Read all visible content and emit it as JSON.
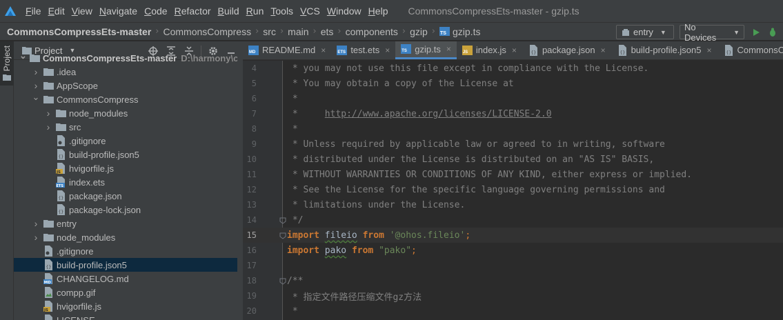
{
  "menu": {
    "items": [
      "File",
      "Edit",
      "View",
      "Navigate",
      "Code",
      "Refactor",
      "Build",
      "Run",
      "Tools",
      "VCS",
      "Window",
      "Help"
    ],
    "window_title": "CommonsCompressEts-master - gzip.ts"
  },
  "breadcrumb": {
    "root": "CommonsCompressEts-master",
    "items": [
      "CommonsCompress",
      "src",
      "main",
      "ets",
      "components",
      "gzip"
    ],
    "file": "gzip.ts"
  },
  "toolbar": {
    "config": "entry",
    "device": "No Devices"
  },
  "stripe": {
    "label": "Project"
  },
  "project_panel": {
    "title": "Project",
    "rows": [
      {
        "name": "CommonsCompressEts-master",
        "note": "D:\\harmony\\cod",
        "indent": 0,
        "chev": "open",
        "icon": "folder"
      },
      {
        "name": ".idea",
        "indent": 1,
        "chev": "closed",
        "icon": "folder"
      },
      {
        "name": "AppScope",
        "indent": 1,
        "chev": "closed",
        "icon": "folder"
      },
      {
        "name": "CommonsCompress",
        "indent": 1,
        "chev": "open",
        "icon": "folder"
      },
      {
        "name": "node_modules",
        "indent": 2,
        "chev": "closed",
        "icon": "folder"
      },
      {
        "name": "src",
        "indent": 2,
        "chev": "closed",
        "icon": "folder"
      },
      {
        "name": ".gitignore",
        "indent": 2,
        "chev": "none",
        "icon": "gitignore"
      },
      {
        "name": "build-profile.json5",
        "indent": 2,
        "chev": "none",
        "icon": "json"
      },
      {
        "name": "hvigorfile.js",
        "indent": 2,
        "chev": "none",
        "icon": "js"
      },
      {
        "name": "index.ets",
        "indent": 2,
        "chev": "none",
        "icon": "ets"
      },
      {
        "name": "package.json",
        "indent": 2,
        "chev": "none",
        "icon": "json"
      },
      {
        "name": "package-lock.json",
        "indent": 2,
        "chev": "none",
        "icon": "json"
      },
      {
        "name": "entry",
        "indent": 1,
        "chev": "closed",
        "icon": "folder"
      },
      {
        "name": "node_modules",
        "indent": 1,
        "chev": "closed",
        "icon": "folder"
      },
      {
        "name": ".gitignore",
        "indent": 1,
        "chev": "none",
        "icon": "gitignore"
      },
      {
        "name": "build-profile.json5",
        "indent": 1,
        "chev": "none",
        "icon": "json",
        "selected": true
      },
      {
        "name": "CHANGELOG.md",
        "indent": 1,
        "chev": "none",
        "icon": "md"
      },
      {
        "name": "compp.gif",
        "indent": 1,
        "chev": "none",
        "icon": "image"
      },
      {
        "name": "hvigorfile.js",
        "indent": 1,
        "chev": "none",
        "icon": "js"
      },
      {
        "name": "LICENSE",
        "indent": 1,
        "chev": "none",
        "icon": "text"
      }
    ]
  },
  "tabs": [
    {
      "label": "README.md",
      "badge": "MD",
      "kind": "md"
    },
    {
      "label": "test.ets",
      "badge": "ETS",
      "kind": "ets"
    },
    {
      "label": "gzip.ts",
      "badge": "TS",
      "kind": "ts",
      "active": true
    },
    {
      "label": "index.js",
      "badge": "JS",
      "kind": "js"
    },
    {
      "label": "package.json",
      "badge": "",
      "kind": "json"
    },
    {
      "label": "build-profile.json5",
      "badge": "",
      "kind": "json"
    },
    {
      "label": "CommonsCompress",
      "badge": "",
      "kind": "json"
    }
  ],
  "code": {
    "lines": [
      {
        "n": "4",
        "text": " * you may not use this file except in compliance with the License."
      },
      {
        "n": "5",
        "text": " * You may obtain a copy of the License at"
      },
      {
        "n": "6",
        "text": " *"
      },
      {
        "n": "7",
        "pre": " *     ",
        "link": "http://www.apache.org/licenses/LICENSE-2.0"
      },
      {
        "n": "8",
        "text": " *"
      },
      {
        "n": "9",
        "text": " * Unless required by applicable law or agreed to in writing, software"
      },
      {
        "n": "10",
        "text": " * distributed under the License is distributed on an \"AS IS\" BASIS,"
      },
      {
        "n": "11",
        "text": " * WITHOUT WARRANTIES OR CONDITIONS OF ANY KIND, either express or implied."
      },
      {
        "n": "12",
        "text": " * See the License for the specific language governing permissions and"
      },
      {
        "n": "13",
        "text": " * limitations under the License."
      },
      {
        "n": "14",
        "text": " */",
        "fold": true
      },
      {
        "n": "15",
        "kw1": "import",
        "id": "fileio",
        "kw2": "from",
        "str": "'@ohos.fileio'",
        "end": ";",
        "fold": true,
        "current": true
      },
      {
        "n": "16",
        "kw1": "import",
        "id": "pako",
        "kw2": "from",
        "str": "\"pako\"",
        "end": ";"
      },
      {
        "n": "17",
        "text": ""
      },
      {
        "n": "18",
        "text": "/**",
        "fold": true
      },
      {
        "n": "19",
        "text": " * 指定文件路径压缩文件gz方法"
      },
      {
        "n": "20",
        "text": " *"
      }
    ]
  }
}
